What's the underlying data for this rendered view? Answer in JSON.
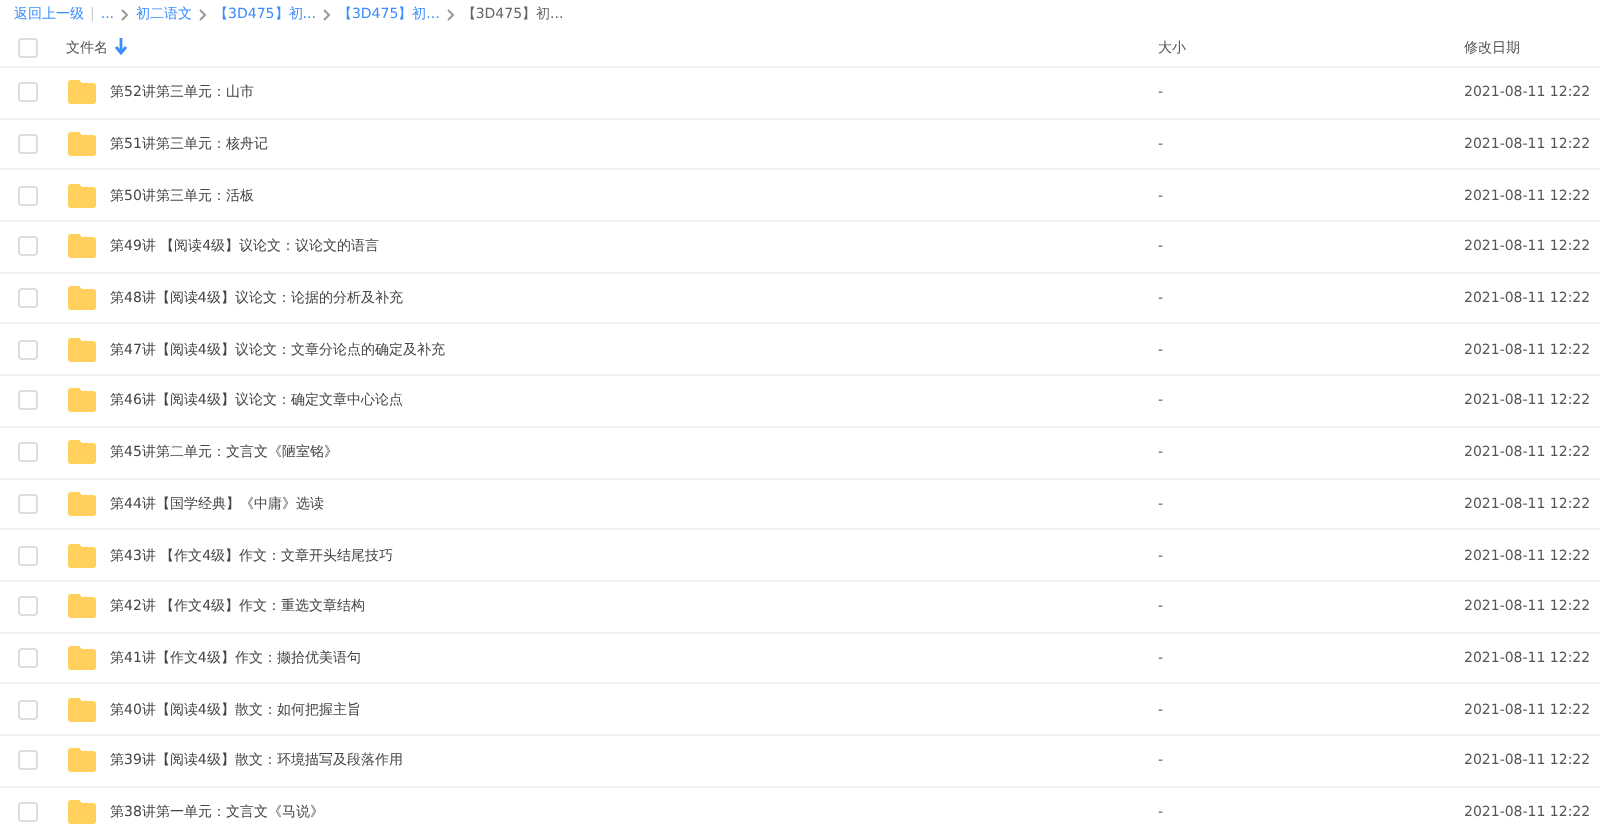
{
  "breadcrumb": {
    "back": "返回上一级",
    "separator": "|",
    "items": [
      {
        "label": "...",
        "current": false
      },
      {
        "label": "初二语文",
        "current": false
      },
      {
        "label": "【3D475】初...",
        "current": false
      },
      {
        "label": "【3D475】初...",
        "current": false
      },
      {
        "label": "【3D475】初...",
        "current": true
      }
    ]
  },
  "table": {
    "columns": [
      {
        "label": "文件名",
        "sorted": true
      },
      {
        "label": "大小",
        "sorted": false
      },
      {
        "label": "修改日期",
        "sorted": false
      }
    ],
    "header_checked": false,
    "rows": [
      {
        "name": "第52讲第三单元：山市",
        "size": "-",
        "date": "2021-08-11 12:22",
        "checked": false
      },
      {
        "name": "第51讲第三单元：核舟记",
        "size": "-",
        "date": "2021-08-11 12:22",
        "checked": false
      },
      {
        "name": "第50讲第三单元：活板",
        "size": "-",
        "date": "2021-08-11 12:22",
        "checked": false
      },
      {
        "name": "第49讲 【阅读4级】议论文：议论文的语言",
        "size": "-",
        "date": "2021-08-11 12:22",
        "checked": false
      },
      {
        "name": "第48讲【阅读4级】议论文：论据的分析及补充",
        "size": "-",
        "date": "2021-08-11 12:22",
        "checked": false
      },
      {
        "name": "第47讲【阅读4级】议论文：文章分论点的确定及补充",
        "size": "-",
        "date": "2021-08-11 12:22",
        "checked": false
      },
      {
        "name": "第46讲【阅读4级】议论文：确定文章中心论点",
        "size": "-",
        "date": "2021-08-11 12:22",
        "checked": false
      },
      {
        "name": "第45讲第二单元：文言文《陋室铭》",
        "size": "-",
        "date": "2021-08-11 12:22",
        "checked": false
      },
      {
        "name": "第44讲【国学经典】《中庸》选读",
        "size": "-",
        "date": "2021-08-11 12:22",
        "checked": false
      },
      {
        "name": "第43讲 【作文4级】作文：文章开头结尾技巧",
        "size": "-",
        "date": "2021-08-11 12:22",
        "checked": false
      },
      {
        "name": "第42讲 【作文4级】作文：重选文章结构",
        "size": "-",
        "date": "2021-08-11 12:22",
        "checked": false
      },
      {
        "name": "第41讲【作文4级】作文：撷拾优美语句",
        "size": "-",
        "date": "2021-08-11 12:22",
        "checked": false
      },
      {
        "name": "第40讲【阅读4级】散文：如何把握主旨",
        "size": "-",
        "date": "2021-08-11 12:22",
        "checked": false
      },
      {
        "name": "第39讲【阅读4级】散文：环境描写及段落作用",
        "size": "-",
        "date": "2021-08-11 12:22",
        "checked": false
      },
      {
        "name": "第38讲第一单元：文言文《马说》",
        "size": "-",
        "date": "2021-08-11 12:22",
        "checked": false
      }
    ]
  }
}
